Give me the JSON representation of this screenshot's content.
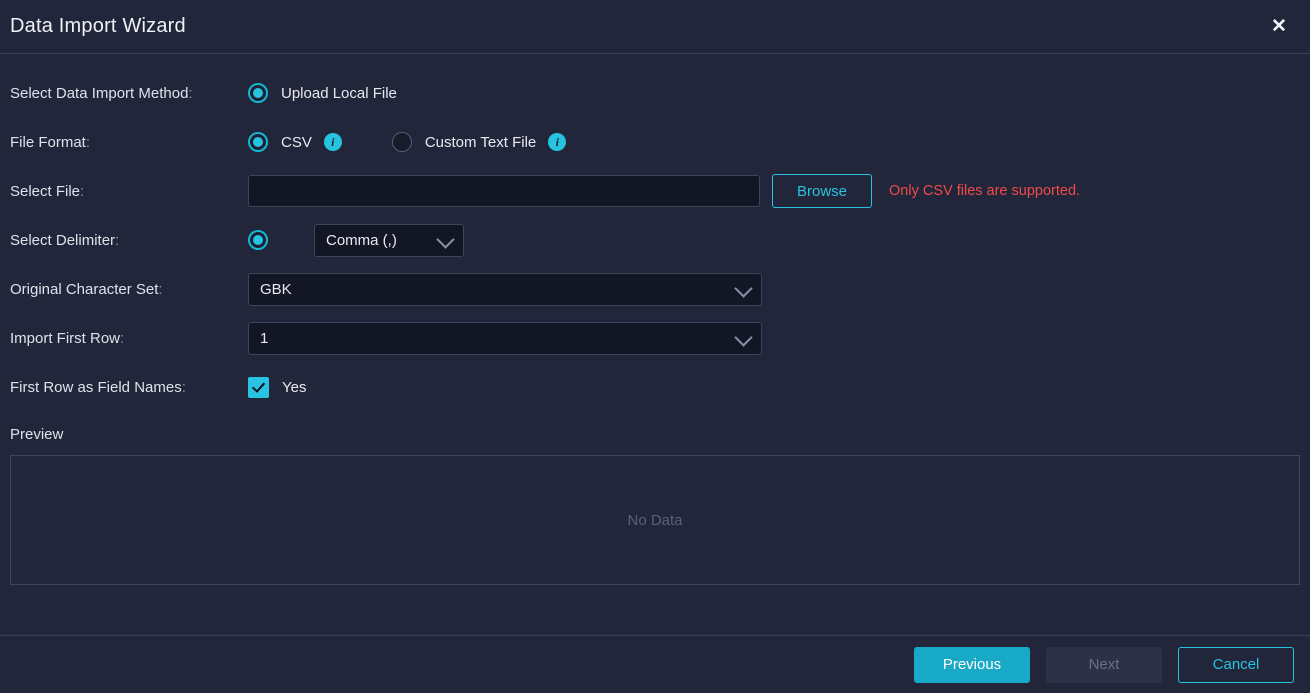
{
  "dialog": {
    "title": "Data Import Wizard",
    "close_icon": "close-icon"
  },
  "form": {
    "import_method": {
      "label": "Select Data Import Method",
      "colon": ":",
      "selected": "Upload Local File",
      "option_label": "Upload Local File"
    },
    "file_format": {
      "label": "File Format",
      "colon": ":",
      "options": [
        {
          "label": "CSV",
          "checked": true,
          "info_icon": "info-icon"
        },
        {
          "label": "Custom Text File",
          "checked": false,
          "info_icon": "info-icon"
        }
      ]
    },
    "select_file": {
      "label": "Select File",
      "colon": ":",
      "value": "",
      "placeholder": "",
      "browse_label": "Browse",
      "warning": "Only CSV files are supported."
    },
    "delimiter": {
      "label": "Select Delimiter",
      "colon": ":",
      "value": "Comma (,)",
      "chevron_icon": "chevron-down-icon"
    },
    "charset": {
      "label": "Original Character Set",
      "colon": ":",
      "value": "GBK",
      "chevron_icon": "chevron-down-icon"
    },
    "first_row": {
      "label": "Import First Row",
      "colon": ":",
      "value": "1",
      "chevron_icon": "chevron-down-icon"
    },
    "field_names": {
      "label": "First Row as Field Names",
      "colon": ":",
      "checked": true,
      "option_label": "Yes"
    }
  },
  "preview": {
    "label": "Preview",
    "empty_text": "No Data"
  },
  "footer": {
    "previous_label": "Previous",
    "next_label": "Next",
    "cancel_label": "Cancel"
  },
  "colors": {
    "accent": "#27c3e0",
    "accent_solid": "#18a9c6",
    "warning": "#f04a4a",
    "background": "#22263a",
    "field_background": "#131725",
    "border": "#3f4459",
    "muted_text": "#5b6078"
  }
}
